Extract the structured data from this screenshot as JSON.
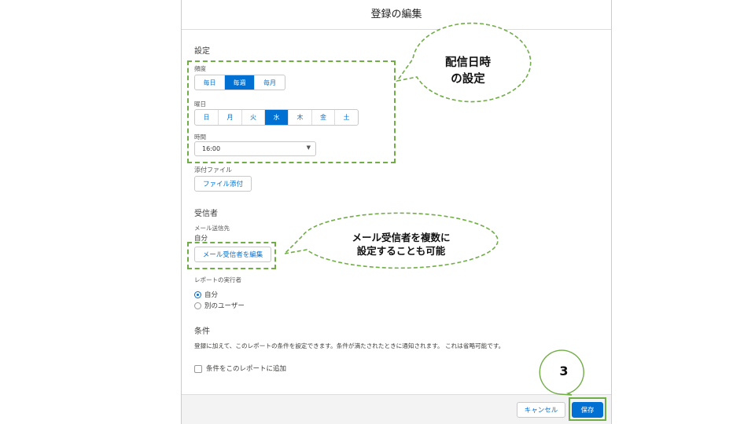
{
  "modal": {
    "title": "登録の編集"
  },
  "settings": {
    "heading": "設定",
    "frequency_label": "頻度",
    "frequency_options": [
      "毎日",
      "毎週",
      "毎月"
    ],
    "frequency_selected": "毎週",
    "day_label": "曜日",
    "day_options": [
      "日",
      "月",
      "火",
      "水",
      "木",
      "金",
      "土"
    ],
    "day_selected": "水",
    "time_label": "時間",
    "time_value": "16:00",
    "attachment_label": "添付ファイル",
    "attach_button": "ファイル添付"
  },
  "recipients": {
    "heading": "受信者",
    "mail_label": "メール送信先",
    "mail_value": "自分",
    "edit_button": "メール受信者を編集",
    "runner_label": "レポートの実行者",
    "runner_options": [
      "自分",
      "別のユーザー"
    ],
    "runner_selected": "自分"
  },
  "conditions": {
    "heading": "条件",
    "description": "登録に加えて、このレポートの条件を設定できます。条件が満たされたときに通知されます。 これは省略可能です。",
    "checkbox_label": "条件をこのレポートに追加",
    "checked": false
  },
  "footer": {
    "cancel": "キャンセル",
    "save": "保存"
  },
  "annotations": {
    "schedule_line1": "配信日時",
    "schedule_line2": "の設定",
    "recipients_line1": "メール受信者を複数に",
    "recipients_line2": "設定することも可能",
    "step": "3",
    "color": "#70ad47"
  },
  "colors": {
    "accent": "#0070d2"
  }
}
